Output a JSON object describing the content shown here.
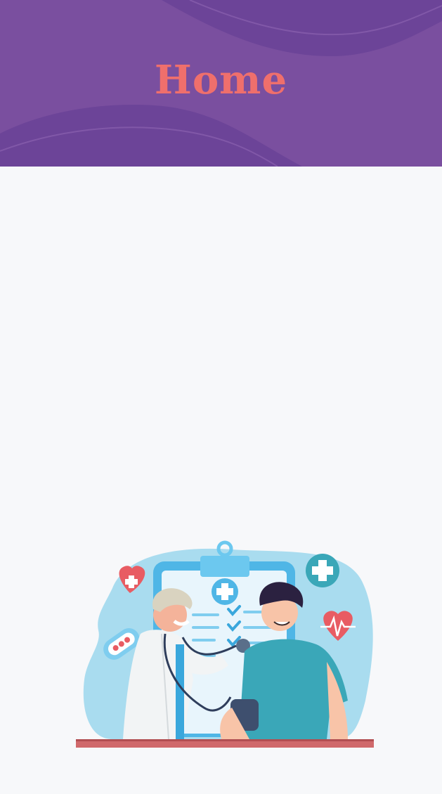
{
  "header": {
    "title": "Home"
  },
  "illustration": {
    "icon": "doctor-patient-checkup-illustration"
  },
  "colors": {
    "header_bg": "#7a4f9f",
    "header_wave": "#6c4498",
    "title": "#ef6f6c",
    "page_bg": "#f7f8fa"
  }
}
